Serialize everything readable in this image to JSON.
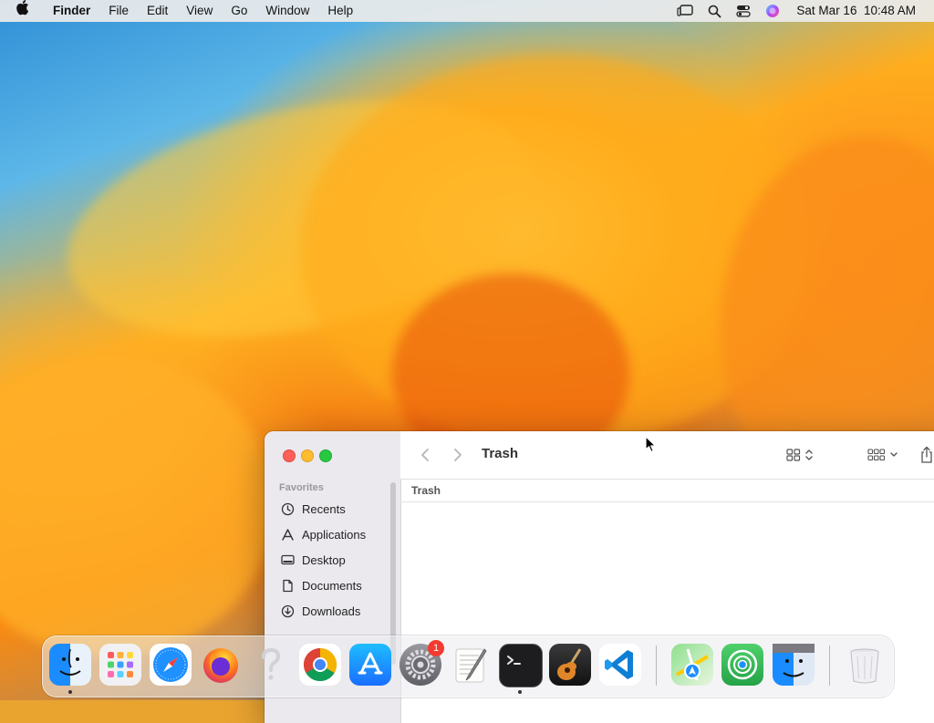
{
  "menubar": {
    "app_name": "Finder",
    "menus": [
      "File",
      "Edit",
      "View",
      "Go",
      "Window",
      "Help"
    ],
    "clock": "Sat Mar 16  10:48 AM"
  },
  "finder": {
    "title": "Trash",
    "path_label": "Trash",
    "sidebar": {
      "section_title": "Favorites",
      "items": [
        "Recents",
        "Applications",
        "Desktop",
        "Documents",
        "Downloads"
      ]
    }
  },
  "dock": {
    "settings_badge": "1"
  }
}
